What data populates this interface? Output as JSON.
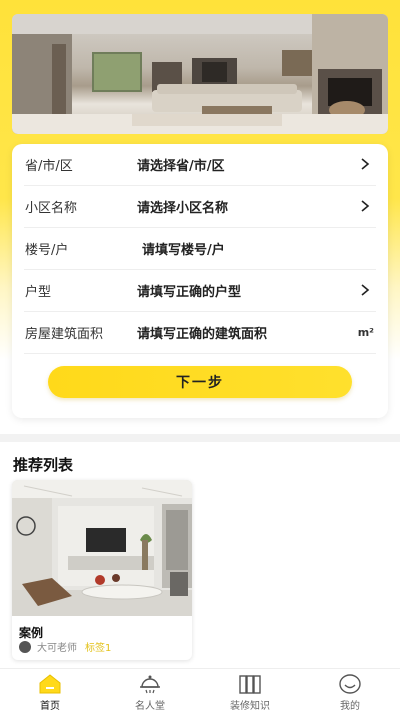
{
  "form": {
    "rows": [
      {
        "label": "省/市/区",
        "value": "请选择省/市/区",
        "has_arrow": true
      },
      {
        "label": "小区名称",
        "value": "请选择小区名称",
        "has_arrow": true
      },
      {
        "label": "楼号/户",
        "value": "请填写楼号/户",
        "has_arrow": false
      },
      {
        "label": "户型",
        "value": "请填写正确的户型",
        "has_arrow": true
      },
      {
        "label": "房屋建筑面积",
        "value": "请填写正确的建筑面积",
        "unit": "m²"
      }
    ],
    "next_label": "下一步"
  },
  "recommend": {
    "title": "推荐列表",
    "items": [
      {
        "title": "案例",
        "author": "大可老师",
        "tag": "标签1"
      }
    ]
  },
  "tabbar": {
    "items": [
      {
        "label": "首页",
        "icon": "home-icon",
        "active": true
      },
      {
        "label": "名人堂",
        "icon": "award-icon",
        "active": false
      },
      {
        "label": "装修知识",
        "icon": "books-icon",
        "active": false
      },
      {
        "label": "我的",
        "icon": "smile-face-icon",
        "active": false
      }
    ]
  },
  "colors": {
    "accent": "#ffd91a",
    "tag": "#e3c21a"
  }
}
